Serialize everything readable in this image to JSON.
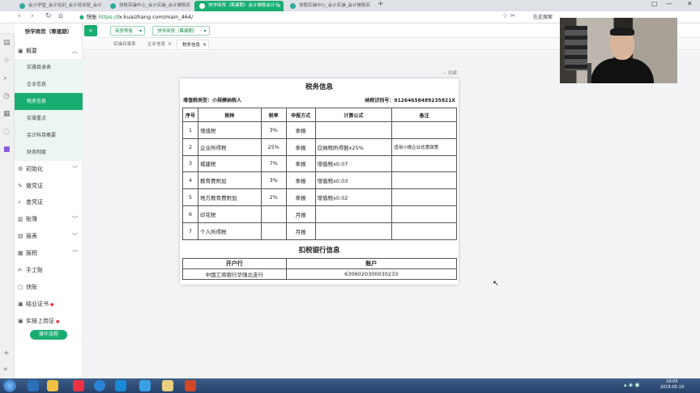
{
  "browser": {
    "tabs": [
      {
        "label": "会计学堂_会计培训_会计培训班_会计"
      },
      {
        "label": "快账实操中心_会计实操_会计做账实"
      },
      {
        "label": "快学商贸（筹建期）会计做账会计长"
      },
      {
        "label": "快账实操中心_会计实操_会计做账实"
      }
    ],
    "url_scheme": "https://",
    "url_rest": "lx.kuaizhang.com/main_464/",
    "url_prefix": "快账",
    "search_label": "在此搜索",
    "new_tab": "+"
  },
  "sidebar": {
    "brand": "快学商贸（筹建期）",
    "groups": [
      {
        "label": "概要",
        "icon": "overview-icon",
        "has_chevron": true
      },
      {
        "label": "初始化",
        "icon": "gear-icon",
        "has_chevron": true
      },
      {
        "label": "做凭证",
        "icon": "pencil-icon",
        "has_chevron": false
      },
      {
        "label": "查凭证",
        "icon": "search-icon",
        "has_chevron": false
      },
      {
        "label": "账簿",
        "icon": "book-icon",
        "has_chevron": true
      },
      {
        "label": "报表",
        "icon": "report-icon",
        "has_chevron": true
      },
      {
        "label": "报税",
        "icon": "tax-icon",
        "has_chevron": true
      },
      {
        "label": "手工账",
        "icon": "hand-icon",
        "has_chevron": false
      },
      {
        "label": "快账",
        "icon": "quick-icon",
        "has_chevron": false
      },
      {
        "label": "结业证书",
        "icon": "certificate-icon",
        "has_chevron": false
      },
      {
        "label": "实操上岗证",
        "icon": "badge-icon",
        "has_chevron": false
      }
    ],
    "overview_items": [
      "实操目录表",
      "企业信息",
      "税务信息",
      "实操重点",
      "会计科目概要",
      "财务制度"
    ],
    "active_item": "税务信息",
    "op_flow_button": "操作流程"
  },
  "header": {
    "collapse_icon": "«",
    "dropdowns": [
      "商贸零售",
      "快学商贸（筹建期）"
    ],
    "page_tabs": [
      {
        "label": "实操目录表",
        "closable": false
      },
      {
        "label": "企业信息",
        "closable": true
      },
      {
        "label": "税务信息",
        "closable": true
      }
    ]
  },
  "tax_info": {
    "favorite": "收藏",
    "title": "税务信息",
    "vat_type": "增值税类型：小规模纳税人",
    "tax_id": "纳税识别号：91264658489235821X",
    "headers": [
      "序号",
      "税种",
      "税率",
      "申报方式",
      "计算公式",
      "备注"
    ],
    "rows": [
      [
        "1",
        "增值税",
        "3%",
        "季报",
        "",
        ""
      ],
      [
        "2",
        "企业所得税",
        "25%",
        "季报",
        "应纳税所得额x25%",
        "适用小微企业优惠政策"
      ],
      [
        "3",
        "城建税",
        "7%",
        "季报",
        "增值税x0.07",
        ""
      ],
      [
        "4",
        "教育费附加",
        "3%",
        "季报",
        "增值税x0.03",
        ""
      ],
      [
        "5",
        "地方教育费附加",
        "2%",
        "季报",
        "增值税x0.02",
        ""
      ],
      [
        "6",
        "印花税",
        "",
        "月报",
        "",
        ""
      ],
      [
        "7",
        "个人所得税",
        "",
        "月报",
        "",
        ""
      ]
    ],
    "bank_title": "扣税银行信息",
    "bank_headers": [
      "开户行",
      "账户"
    ],
    "bank_row": [
      "中国工商银行华强北支行",
      "6306020300030233"
    ]
  },
  "taskbar": {
    "time": "19:05",
    "date": "2019-05-19"
  }
}
